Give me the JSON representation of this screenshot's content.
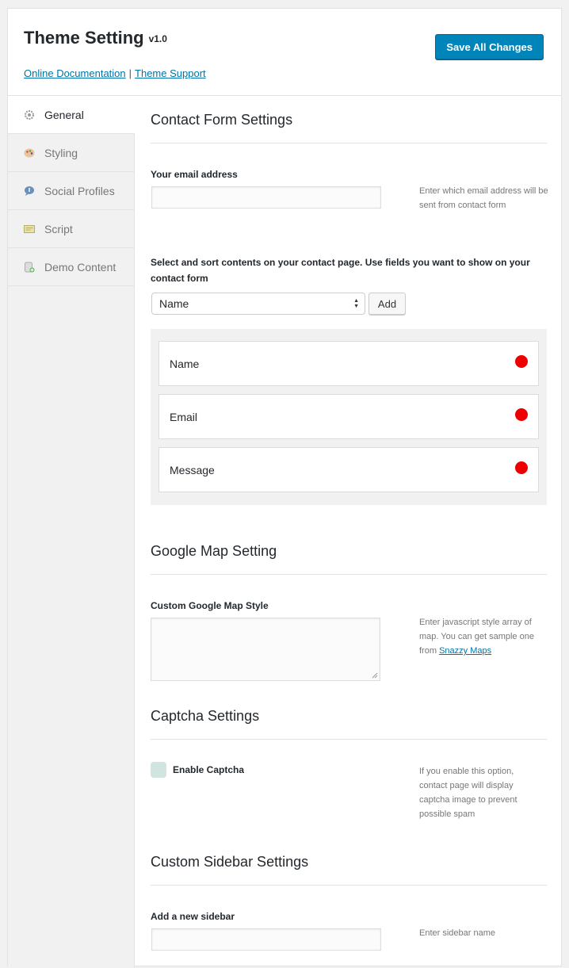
{
  "header": {
    "title": "Theme Setting",
    "version": "v1.0",
    "docs_link": "Online Documentation",
    "separator": "|",
    "support_link": "Theme Support",
    "save_label": "Save All Changes"
  },
  "sidebar": {
    "items": [
      {
        "label": "General",
        "icon": "gear-icon",
        "active": true
      },
      {
        "label": "Styling",
        "icon": "palette-icon",
        "active": false
      },
      {
        "label": "Social Profiles",
        "icon": "chat-icon",
        "active": false
      },
      {
        "label": "Script",
        "icon": "script-icon",
        "active": false
      },
      {
        "label": "Demo Content",
        "icon": "database-icon",
        "active": false
      }
    ]
  },
  "contact": {
    "title": "Contact Form Settings",
    "email_label": "Your email address",
    "email_value": "",
    "email_desc": "Enter which email address will be sent from contact form",
    "sort_label": "Select and sort contents on your contact page. Use fields you want to show on your contact form",
    "select_value": "Name",
    "add_label": "Add",
    "fields": [
      "Name",
      "Email",
      "Message"
    ]
  },
  "map": {
    "title": "Google Map Setting",
    "style_label": "Custom Google Map Style",
    "style_value": "",
    "desc": "Enter javascript style array of map. You can get sample one from",
    "desc_link": "Snazzy Maps"
  },
  "captcha": {
    "title": "Captcha Settings",
    "enable_label": "Enable Captcha",
    "desc": "If you enable this option, contact page will display captcha image to prevent possible spam"
  },
  "custom_sidebar": {
    "title": "Custom Sidebar Settings",
    "add_label": "Add a new sidebar",
    "input_value": "",
    "desc": "Enter sidebar name"
  },
  "colors": {
    "primary": "#0085ba",
    "link": "#0073aa",
    "remove_dot": "#ee0000",
    "checkbox": "#d0e5df"
  }
}
